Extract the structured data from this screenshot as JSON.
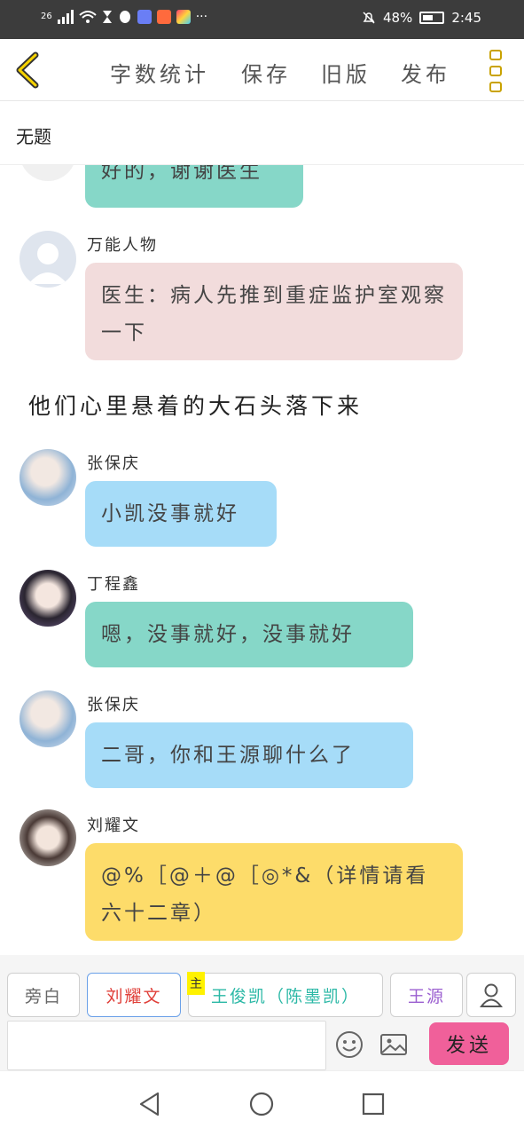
{
  "status_bar": {
    "signal": "26",
    "battery": "48%",
    "time": "2:45"
  },
  "toolbar": {
    "word_count": "字数统计",
    "save": "保存",
    "old_version": "旧版",
    "publish": "发布"
  },
  "title": "无题",
  "messages": [
    {
      "name": "",
      "text": "好的，谢谢医生",
      "color": "#86d7c8"
    },
    {
      "name": "万能人物",
      "text": "医生：病人先推到重症监护室观察一下",
      "color": "#f2dcdc"
    },
    {
      "narration": "他们心里悬着的大石头落下来"
    },
    {
      "name": "张保庆",
      "text": "小凯没事就好",
      "color": "#a6dcf8"
    },
    {
      "name": "丁程鑫",
      "text": "嗯，没事就好，没事就好",
      "color": "#86d7c8"
    },
    {
      "name": "张保庆",
      "text": "二哥，你和王源聊什么了",
      "color": "#a6dcf8"
    },
    {
      "name": "刘耀文",
      "text": "@%［@＋@［◎*&（详情请看六十二章）",
      "color": "#fddc6a"
    }
  ],
  "roles": [
    {
      "label": "旁白",
      "color": "#666666"
    },
    {
      "label": "刘耀文",
      "color": "#e0403a",
      "selected": true
    },
    {
      "label": "王俊凯（陈墨凯）",
      "color": "#2bb8a6",
      "tag": "主"
    },
    {
      "label": "王源",
      "color": "#9b5fd0"
    }
  ],
  "input": {
    "placeholder": "",
    "send": "发送"
  },
  "icons": {
    "back": "chevron-left-icon",
    "more": "three-squares-icon",
    "profile": "person-icon",
    "emoji": "smiley-icon",
    "image": "image-icon",
    "nav_back": "triangle-back-icon",
    "nav_home": "circle-home-icon",
    "nav_recent": "square-recent-icon"
  }
}
